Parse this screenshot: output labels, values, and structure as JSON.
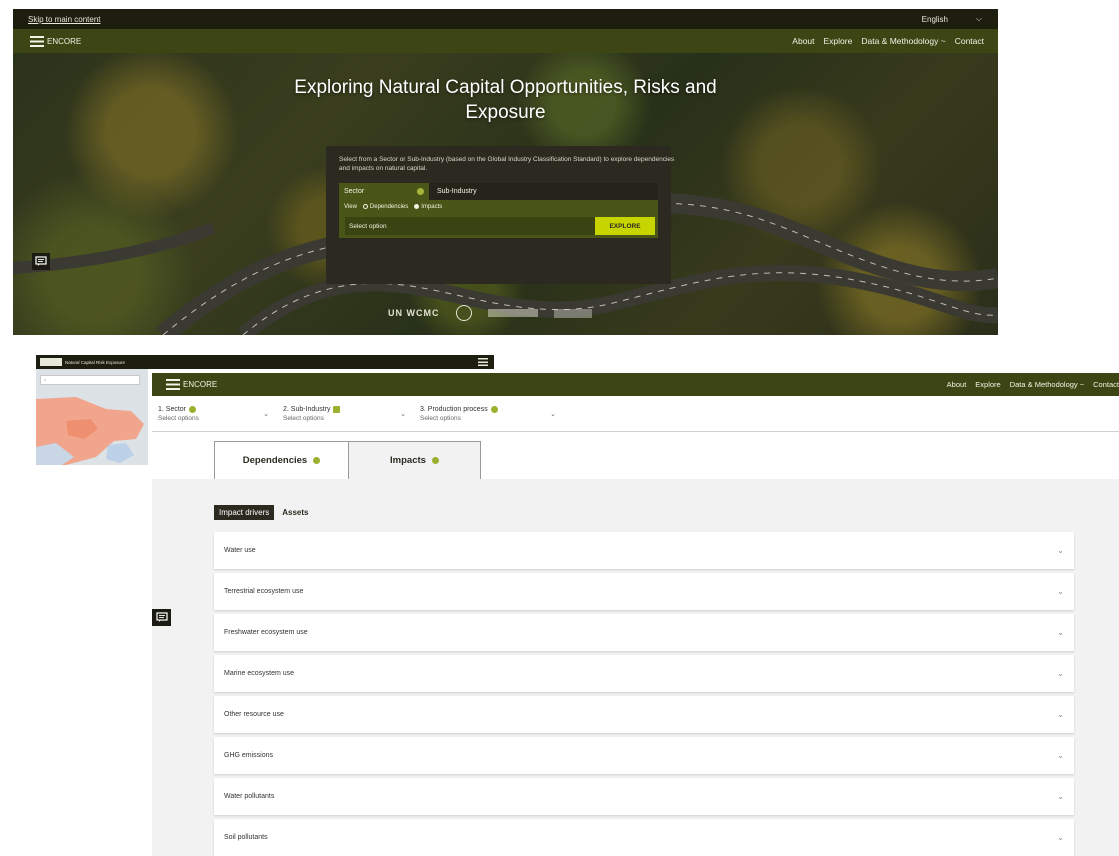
{
  "landing": {
    "skip_link": "Skip to main content",
    "language": "English",
    "brand": "ENCORE",
    "nav": [
      "About",
      "Explore",
      "Data & Methodology ~",
      "Contact"
    ],
    "hero_title_line1": "Exploring Natural Capital Opportunities, Risks and",
    "hero_title_line2": "Exposure",
    "description": "Select from a Sector or Sub-Industry (based on the Global Industry Classification Standard) to explore dependencies and impacts on natural capital.",
    "sector_label": "Sector",
    "subindustry_label": "Sub-Industry",
    "view_label": "View",
    "option_dependencies": "Dependencies",
    "option_impacts": "Impacts",
    "select_placeholder": "Select option",
    "explore_button": "EXPLORE",
    "partner_logo": "UN   WCMC"
  },
  "map_view": {
    "brand": "ENCORE",
    "caption": "Natural Capital Risk Exposure"
  },
  "explorer": {
    "brand": "ENCORE",
    "nav": [
      "About",
      "Explore",
      "Data & Methodology ~",
      "Contact"
    ],
    "steps": [
      {
        "title": "1. Sector",
        "sub": "Select options"
      },
      {
        "title": "2. Sub-Industry",
        "sub": "Select options"
      },
      {
        "title": "3. Production process",
        "sub": "Select options"
      }
    ],
    "tabs": [
      "Dependencies",
      "Impacts"
    ],
    "subtabs": [
      "Impact drivers",
      "Assets"
    ],
    "drivers": [
      "Water use",
      "Terrestrial ecosystem use",
      "Freshwater ecosystem use",
      "Marine ecosystem use",
      "Other resource use",
      "GHG emissions",
      "Water pollutants",
      "Soil pollutants"
    ]
  },
  "colors": {
    "nav_olive": "#3c4513",
    "top_dark": "#1e1e10",
    "accent_lime": "#c7d400",
    "status_green": "#9bb02f"
  }
}
